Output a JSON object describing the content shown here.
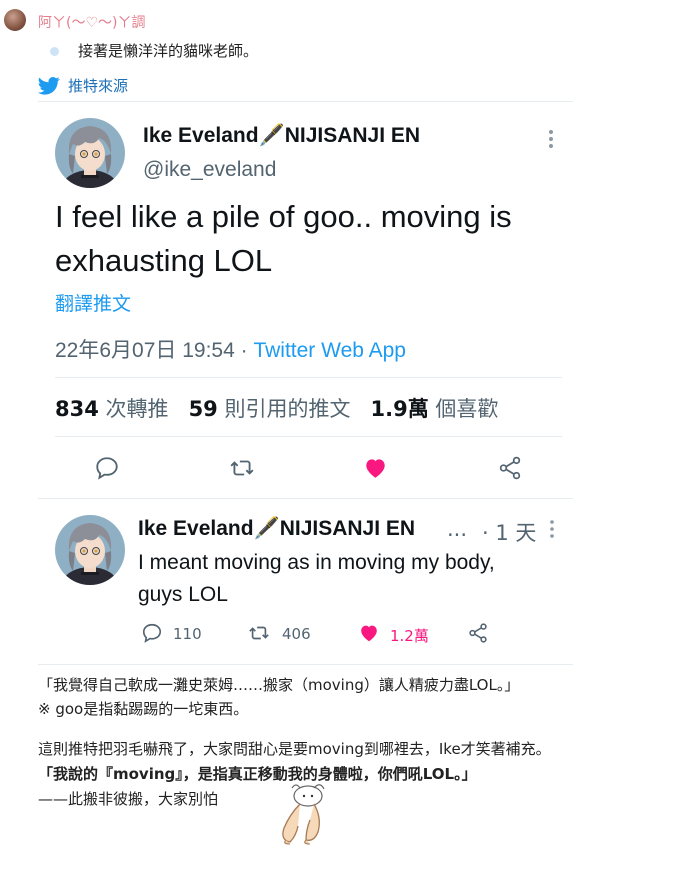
{
  "post": {
    "author": "阿ㄚ(〜♡〜)ㄚ調",
    "intro": "接著是懶洋洋的貓咪老師。",
    "source_label": "推特來源"
  },
  "main_tweet": {
    "display_name": "Ike Eveland🖋️NIJISANJI EN",
    "handle": "@ike_eveland",
    "text_line1": "I feel like a pile of goo.. moving is",
    "text_line2": "exhausting LOL",
    "translate": "翻譯推文",
    "timestamp": "22年6月07日 19:54 · ",
    "app": "Twitter Web App",
    "retweets_count": "834",
    "retweets_label": " 次轉推",
    "quotes_count": "59",
    "quotes_label": " 則引用的推文",
    "likes_count": "1.9萬",
    "likes_label": " 個喜歡"
  },
  "reply_tweet": {
    "display_name": "Ike Eveland🖋️NIJISANJI EN",
    "truncation": "...",
    "time": "· 1 天",
    "text_line1": "I meant moving as in moving my body,",
    "text_line2": "guys LOL",
    "replies": "110",
    "retweets": "406",
    "likes": "1.2萬"
  },
  "article": {
    "line1": "「我覺得自己軟成一灘史萊姆……搬家（moving）讓人精疲力盡LOL。」",
    "line2": "※ goo是指黏踢踢的一坨東西。",
    "line3": "這則推特把羽毛嚇飛了，大家問甜心是要moving到哪裡去，Ike才笑著補充。",
    "line4": "「我說的『moving』，是指真正移動我的身體啦，你們吼LOL。」",
    "line5": "——此搬非彼搬，大家別怕"
  },
  "colors": {
    "twitter_blue": "#1d9bf0",
    "like_pink": "#f91880",
    "author_pink": "#e57d8c",
    "gray": "#536471"
  },
  "icons": [
    "twitter-bird-icon",
    "more-options-icon",
    "reply-icon",
    "retweet-icon",
    "heart-icon",
    "share-icon",
    "rabbit-sticker-icon"
  ]
}
